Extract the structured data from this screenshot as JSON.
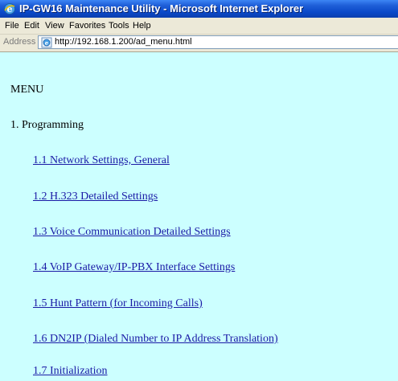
{
  "window": {
    "title": "IP-GW16 Maintenance Utility - Microsoft Internet Explorer",
    "icon": "ie-icon"
  },
  "menubar": {
    "items": [
      "File",
      "Edit",
      "View",
      "Favorites",
      "Tools",
      "Help"
    ]
  },
  "addressbar": {
    "label": "Address",
    "url": "http://192.168.1.200/ad_menu.html",
    "icon": "page-icon"
  },
  "content": {
    "background": "#ccffff",
    "link_color": "#1a1aa6",
    "heading": "MENU",
    "section": "1. Programming",
    "links": [
      "1.1 Network Settings, General",
      "1.2 H.323 Detailed Settings",
      "1.3 Voice Communication Detailed Settings",
      "1.4 VoIP Gateway/IP-PBX Interface Settings",
      "1.5 Hunt Pattern (for Incoming Calls)",
      "1.6 DN2IP (Dialed Number to IP Address Translation)",
      "1.7 Initialization"
    ]
  }
}
